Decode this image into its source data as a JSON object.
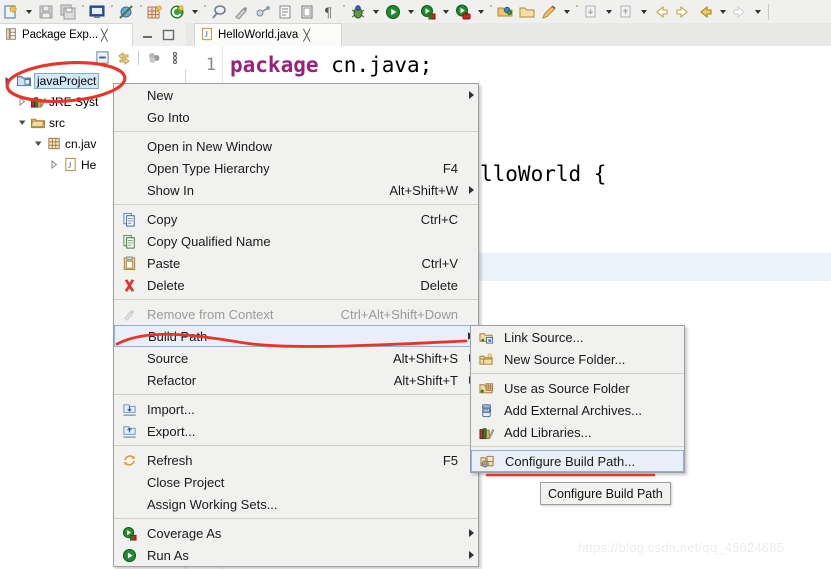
{
  "toolbar": {
    "items": [
      {
        "name": "new-wizard-icon",
        "type": "icon"
      },
      {
        "name": "new-wizard-dropdown-arrow",
        "type": "arrow"
      },
      {
        "name": "save-icon",
        "type": "icon"
      },
      {
        "name": "save-all-icon",
        "type": "icon"
      },
      {
        "name": "separator",
        "type": "sep"
      },
      {
        "name": "toggle-console-icon",
        "type": "icon"
      },
      {
        "name": "separator",
        "type": "sep"
      },
      {
        "name": "skip-breakpoints-icon",
        "type": "icon"
      },
      {
        "name": "separator",
        "type": "sep"
      },
      {
        "name": "new-java-class-icon",
        "type": "icon"
      },
      {
        "name": "new-java-package-icon",
        "type": "icon"
      },
      {
        "name": "new-java-package-dropdown-arrow",
        "type": "arrow"
      },
      {
        "name": "separator",
        "type": "sep"
      },
      {
        "name": "search-icon",
        "type": "icon"
      },
      {
        "name": "build-icon",
        "type": "icon"
      },
      {
        "name": "link-editor-icon",
        "type": "icon"
      },
      {
        "name": "open-task-icon",
        "type": "icon"
      },
      {
        "name": "open-type-icon",
        "type": "icon"
      },
      {
        "name": "pilcrow-icon",
        "type": "icon"
      },
      {
        "name": "separator",
        "type": "sep"
      },
      {
        "name": "debug-icon",
        "type": "icon"
      },
      {
        "name": "debug-dropdown-arrow",
        "type": "arrow"
      },
      {
        "name": "run-icon",
        "type": "icon"
      },
      {
        "name": "run-dropdown-arrow",
        "type": "arrow"
      },
      {
        "name": "coverage-icon",
        "type": "icon"
      },
      {
        "name": "coverage-dropdown-arrow",
        "type": "arrow"
      },
      {
        "name": "profile-icon",
        "type": "icon"
      },
      {
        "name": "profile-dropdown-arrow",
        "type": "arrow"
      },
      {
        "name": "separator",
        "type": "sep"
      },
      {
        "name": "open-perspective-icon",
        "type": "icon"
      },
      {
        "name": "open-resource-icon",
        "type": "icon"
      },
      {
        "name": "annotation-icon",
        "type": "icon"
      },
      {
        "name": "annotation-dropdown-arrow",
        "type": "arrow"
      },
      {
        "name": "separator",
        "type": "sep"
      },
      {
        "name": "previous-annotation-icon",
        "type": "icon"
      },
      {
        "name": "previous-annotation-dropdown-arrow",
        "type": "arrow"
      },
      {
        "name": "next-annotation-icon",
        "type": "icon"
      },
      {
        "name": "next-annotation-dropdown-arrow",
        "type": "arrow"
      },
      {
        "name": "back-icon",
        "type": "icon"
      },
      {
        "name": "forward-icon",
        "type": "icon"
      },
      {
        "name": "back-history-icon",
        "type": "icon"
      },
      {
        "name": "back-history-dropdown-arrow",
        "type": "arrow"
      },
      {
        "name": "forward-history-icon",
        "type": "icon"
      },
      {
        "name": "forward-history-dropdown-arrow",
        "type": "arrow"
      },
      {
        "name": "end-bar",
        "type": "bar"
      }
    ]
  },
  "package_explorer": {
    "tab_label": "Package Exp...",
    "tab_close": "╳",
    "tree": [
      {
        "label": "javaProject",
        "icon": "java-project-icon",
        "arrow": "collapsed-filled",
        "indent": 0,
        "selected": true
      },
      {
        "label": "JRE Syst",
        "icon": "jre-library-icon",
        "arrow": "collapsed",
        "indent": 1,
        "selected": false
      },
      {
        "label": "src",
        "icon": "source-folder-icon",
        "arrow": "expanded",
        "indent": 1,
        "selected": false
      },
      {
        "label": "cn.jav",
        "icon": "package-icon",
        "arrow": "expanded",
        "indent": 2,
        "selected": false
      },
      {
        "label": "He",
        "icon": "java-file-icon",
        "arrow": "collapsed",
        "indent": 3,
        "selected": false
      }
    ]
  },
  "editor": {
    "tab_label": "HelloWorld.java",
    "tab_close": "╳",
    "lines": [
      {
        "number": "1",
        "keyword": "package",
        "rest": " cn.java;"
      },
      {
        "number": "",
        "keyword": "",
        "rest": "lloWorld {"
      }
    ],
    "line1_number": "1",
    "line1_keyword": "package",
    "line1_rest": " cn.java;",
    "line3_visible": "lloWorld {"
  },
  "context_menu": {
    "items": [
      {
        "label": "New",
        "accel": "",
        "submenu": true,
        "icon": "",
        "disabled": false,
        "sep_after": true
      },
      {
        "label": "Go Into",
        "accel": "",
        "submenu": false,
        "icon": "",
        "disabled": false,
        "sep_after": false
      },
      {
        "label": "Open in New Window",
        "accel": "",
        "submenu": false,
        "icon": "",
        "disabled": false,
        "sep_after": false
      },
      {
        "label": "Open Type Hierarchy",
        "accel": "F4",
        "submenu": false,
        "icon": "",
        "disabled": false,
        "sep_after": false
      },
      {
        "label": "Show In",
        "accel": "Alt+Shift+W",
        "submenu": true,
        "icon": "",
        "disabled": false,
        "sep_after": true
      },
      {
        "label": "Copy",
        "accel": "Ctrl+C",
        "submenu": false,
        "icon": "copy-icon",
        "disabled": false,
        "sep_after": false
      },
      {
        "label": "Copy Qualified Name",
        "accel": "",
        "submenu": false,
        "icon": "copy-qualified-icon",
        "disabled": false,
        "sep_after": false
      },
      {
        "label": "Paste",
        "accel": "Ctrl+V",
        "submenu": false,
        "icon": "paste-icon",
        "disabled": false,
        "sep_after": false
      },
      {
        "label": "Delete",
        "accel": "Delete",
        "submenu": false,
        "icon": "delete-icon",
        "disabled": false,
        "sep_after": true
      },
      {
        "label": "Remove from Context",
        "accel": "Ctrl+Alt+Shift+Down",
        "submenu": false,
        "icon": "remove-context-icon",
        "disabled": true,
        "sep_after": false
      },
      {
        "label": "Build Path",
        "accel": "",
        "submenu": true,
        "icon": "",
        "disabled": false,
        "highlighted": true,
        "sep_after": false
      },
      {
        "label": "Source",
        "accel": "Alt+Shift+S",
        "submenu": true,
        "icon": "",
        "disabled": false,
        "sep_after": false
      },
      {
        "label": "Refactor",
        "accel": "Alt+Shift+T",
        "submenu": true,
        "icon": "",
        "disabled": false,
        "sep_after": true
      },
      {
        "label": "Import...",
        "accel": "",
        "submenu": false,
        "icon": "import-icon",
        "disabled": false,
        "sep_after": false
      },
      {
        "label": "Export...",
        "accel": "",
        "submenu": false,
        "icon": "export-icon",
        "disabled": false,
        "sep_after": true
      },
      {
        "label": "Refresh",
        "accel": "F5",
        "submenu": false,
        "icon": "refresh-icon",
        "disabled": false,
        "sep_after": false
      },
      {
        "label": "Close Project",
        "accel": "",
        "submenu": false,
        "icon": "",
        "disabled": false,
        "sep_after": false
      },
      {
        "label": "Assign Working Sets...",
        "accel": "",
        "submenu": false,
        "icon": "",
        "disabled": false,
        "sep_after": true
      },
      {
        "label": "Coverage As",
        "accel": "",
        "submenu": true,
        "icon": "coverage-icon",
        "disabled": false,
        "sep_after": false
      },
      {
        "label": "Run As",
        "accel": "",
        "submenu": true,
        "icon": "run-icon",
        "disabled": false,
        "sep_after": false
      }
    ]
  },
  "build_path_submenu": {
    "items": [
      {
        "label": "Link Source...",
        "icon": "link-source-icon",
        "sep_after": false
      },
      {
        "label": "New Source Folder...",
        "icon": "new-source-folder-icon",
        "sep_after": true
      },
      {
        "label": "Use as Source Folder",
        "icon": "use-as-source-folder-icon",
        "sep_after": false
      },
      {
        "label": "Add External Archives...",
        "icon": "add-external-archives-icon",
        "sep_after": false
      },
      {
        "label": "Add Libraries...",
        "icon": "add-libraries-icon",
        "sep_after": true
      },
      {
        "label": "Configure Build Path...",
        "icon": "configure-build-path-icon",
        "highlighted": true,
        "sep_after": false
      }
    ]
  },
  "tooltip": {
    "text": "Configure Build Path"
  },
  "watermark": {
    "text": "https://blog.csdn.net/qq_45624685"
  },
  "colors": {
    "menu_bg": "#f1f1f0",
    "menu_border": "#a0a0a0",
    "highlight_bg": "#e9effa",
    "highlight_border": "#8fb0dd",
    "selection_bg": "#d4e7f7",
    "keyword": "#9c217c",
    "annotation_red": "#e8352a",
    "editor_highlight": "#eaf2fc",
    "toolbar_bg": "#f0f0ef"
  }
}
